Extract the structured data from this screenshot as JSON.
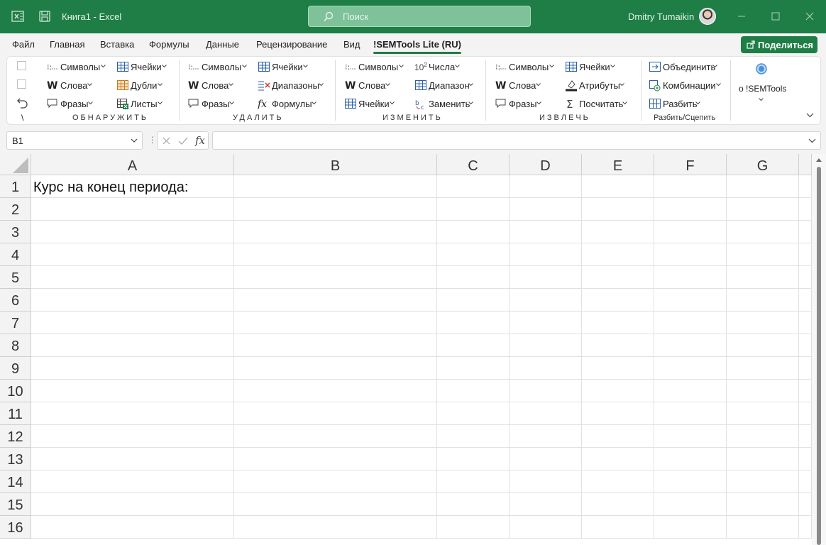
{
  "titlebar": {
    "doc_title": "Книга1  -  Excel",
    "search_placeholder": "Поиск",
    "user_name": "Dmitry Tumaikin"
  },
  "menu": {
    "items": [
      "Файл",
      "Главная",
      "Вставка",
      "Формулы",
      "Данные",
      "Рецензирование",
      "Вид",
      "!SEMTools Lite (RU)"
    ],
    "active": "!SEMTools Lite (RU)",
    "share_label": "Поделиться"
  },
  "ribbon": {
    "groups": [
      {
        "label": "ОБНАРУЖИТЬ",
        "buttons": [
          "Символы",
          "Ячейки",
          "Слова",
          "Дубли",
          "Фразы",
          "Листы"
        ]
      },
      {
        "label": "УДАЛИТЬ",
        "buttons": [
          "Символы",
          "Ячейки",
          "Слова",
          "Диапазоны",
          "Фразы",
          "Формулы"
        ]
      },
      {
        "label": "ИЗМЕНИТЬ",
        "buttons": [
          "Символы",
          "Числа",
          "Слова",
          "Диапазон",
          "Ячейки",
          "Заменить"
        ]
      },
      {
        "label": "ИЗВЛЕЧЬ",
        "buttons": [
          "Символы",
          "Ячейки",
          "Слова",
          "Атрибуты",
          "Фразы",
          "Посчитать"
        ]
      },
      {
        "label": "Разбить/Сцепить",
        "buttons": [
          "Объединить",
          "Комбинации",
          "Разбить"
        ]
      }
    ],
    "about_label": "о !SEMTools",
    "left_mark": "\\",
    "numbers_icon_text": "10"
  },
  "formula_bar": {
    "name_box": "B1",
    "formula": ""
  },
  "sheet": {
    "columns": [
      "A",
      "B",
      "C",
      "D",
      "E",
      "F",
      "G"
    ],
    "rows": [
      "1",
      "2",
      "3",
      "4",
      "5",
      "6",
      "7",
      "8",
      "9",
      "10",
      "11",
      "12",
      "13",
      "14",
      "15",
      "16"
    ],
    "cells": {
      "A1": "Курс на конец периода:"
    }
  }
}
